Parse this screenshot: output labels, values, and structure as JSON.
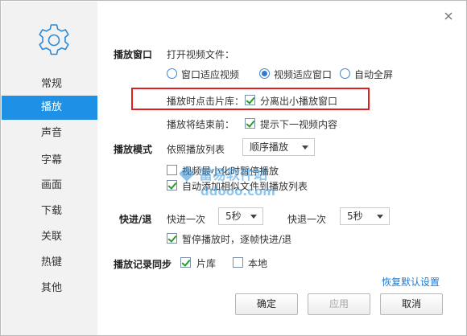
{
  "sidebar": {
    "icon": "gear-icon",
    "items": [
      {
        "label": "常规"
      },
      {
        "label": "播放"
      },
      {
        "label": "声音"
      },
      {
        "label": "字幕"
      },
      {
        "label": "画面"
      },
      {
        "label": "下载"
      },
      {
        "label": "关联"
      },
      {
        "label": "热键"
      },
      {
        "label": "其他"
      }
    ],
    "active_index": 1
  },
  "play_window": {
    "section": "播放窗口",
    "open_file_label": "打开视频文件：",
    "options": [
      "窗口适应视频",
      "视频适应窗口",
      "自动全屏"
    ],
    "selected": "视频适应窗口",
    "click_label": "播放时点击片库：",
    "click_option": "分离出小播放窗口",
    "end_label": "播放将结束前：",
    "end_option": "提示下一视频内容"
  },
  "play_mode": {
    "section": "播放模式",
    "list_label": "依照播放列表",
    "order_value": "顺序播放",
    "minimize_pause": "视频最小化时暂停播放",
    "auto_add": "自动添加相似文件到播放列表"
  },
  "seek": {
    "section": "快进/退",
    "forward_label": "快进一次",
    "forward_value": "5秒",
    "backward_label": "快退一次",
    "backward_value": "5秒",
    "pause_seek": "暂停播放时，逐帧快进/退"
  },
  "history": {
    "section": "播放记录同步",
    "library": "片库",
    "local": "本地"
  },
  "actions": {
    "restore": "恢复默认设置",
    "ok": "确定",
    "apply": "应用",
    "cancel": "取消"
  },
  "watermark": {
    "text": "當易软件站",
    "url": "ddooo.com"
  },
  "colors": {
    "accent": "#1e90e6",
    "highlight_box": "#e11d1d",
    "link": "#1a78d4"
  }
}
